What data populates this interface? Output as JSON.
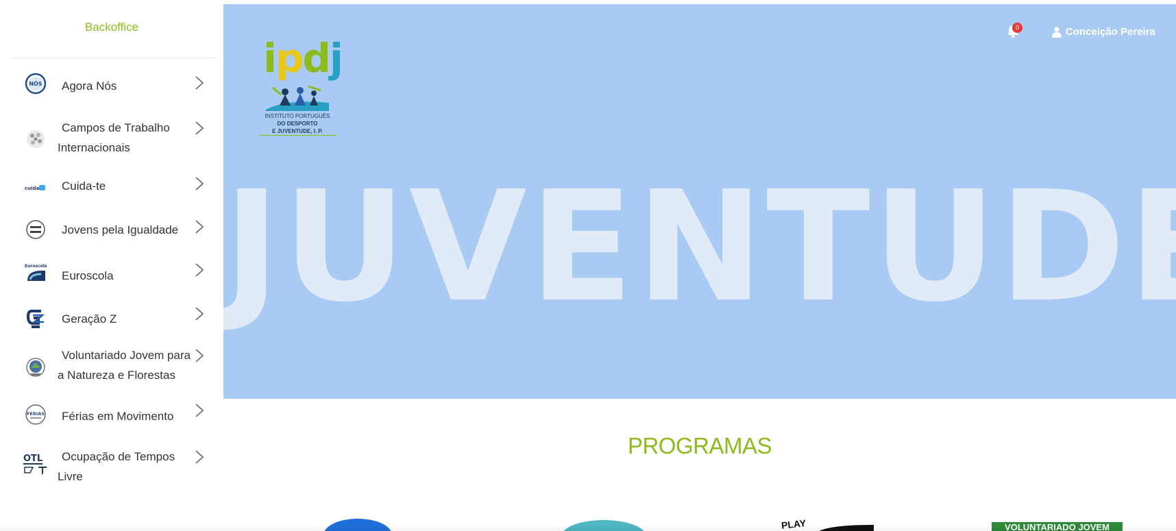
{
  "sidebar": {
    "title": "Backoffice",
    "items": [
      {
        "label": "Agora Nós",
        "icon": "agora-nos-logo-icon"
      },
      {
        "label": "Campos de Trabalho Internacionais",
        "icon": "campos-trabalho-logo-icon"
      },
      {
        "label": "Cuida-te",
        "icon": "cuida-te-logo-icon"
      },
      {
        "label": "Jovens pela Igualdade",
        "icon": "jovens-igualdade-logo-icon"
      },
      {
        "label": "Euroscola",
        "icon": "euroscola-logo-icon"
      },
      {
        "label": "Geração Z",
        "icon": "geracao-z-logo-icon"
      },
      {
        "label": "Voluntariado Jovem para a Natureza e Florestas",
        "icon": "voluntariado-logo-icon"
      },
      {
        "label": "Férias em Movimento",
        "icon": "ferias-movimento-logo-icon"
      },
      {
        "label": "Ocupação de Tempos Livre",
        "icon": "otl-logo-icon"
      }
    ]
  },
  "header": {
    "notification_count": "0",
    "user_name": "Conceição Pereira"
  },
  "hero": {
    "logo_word": "ipdj",
    "logo_line1": "INSTITUTO PORTUGUÊS",
    "logo_line2": "DO DESPORTO",
    "logo_line3": "E JUVENTUDE, I. P.",
    "headline": "JUVENTUDE"
  },
  "programs": {
    "title": "PROGRAMAS",
    "tile_partial_text_1": "PLAY",
    "tile_partial_text_2": "VOLUNTARIADO JOVEM"
  },
  "colors": {
    "accent_green": "#8dbb1d",
    "hero_blue": "#a9cbf3",
    "badge_red": "#e53935"
  }
}
